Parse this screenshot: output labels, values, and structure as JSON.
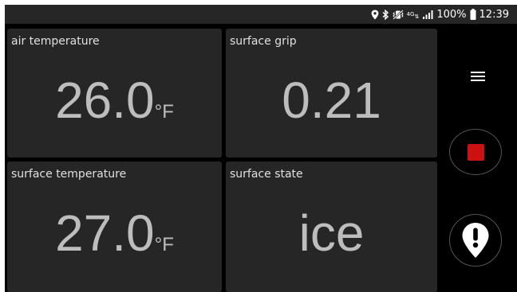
{
  "status_bar": {
    "battery_text": "100%",
    "time": "12:39",
    "network_label": "4G",
    "icons": [
      "location-icon",
      "bluetooth-icon",
      "vibrate-icon",
      "network-icon",
      "signal-icon",
      "battery-icon"
    ]
  },
  "tiles": [
    {
      "label": "air temperature",
      "value": "26.0",
      "unit": "°F"
    },
    {
      "label": "surface grip",
      "value": "0.21",
      "unit": ""
    },
    {
      "label": "surface temperature",
      "value": "27.0",
      "unit": "°F"
    },
    {
      "label": "surface state",
      "value": "ice",
      "unit": ""
    }
  ],
  "side_panel": {
    "icons": [
      "menu-icon",
      "stop-icon",
      "alert-pin-icon"
    ]
  },
  "colors": {
    "tile_bg": "#262626",
    "value_text": "#bdbdbd",
    "stop_red": "#cc1111",
    "background": "#000000"
  }
}
